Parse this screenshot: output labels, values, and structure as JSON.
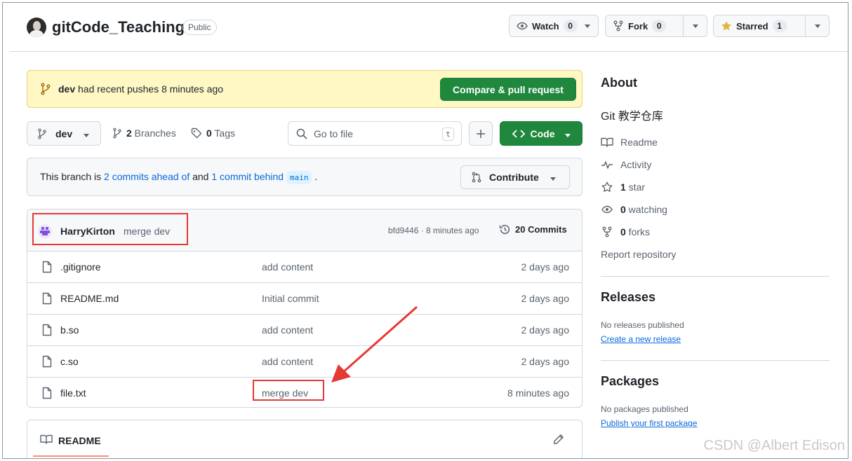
{
  "repo": {
    "name": "gitCode_Teaching",
    "visibility": "Public",
    "watch": {
      "label": "Watch",
      "count": "0"
    },
    "fork": {
      "label": "Fork",
      "count": "0"
    },
    "star": {
      "label": "Starred",
      "count": "1"
    }
  },
  "banner": {
    "branch": "dev",
    "text": " had recent pushes 8 minutes ago",
    "button": "Compare & pull request"
  },
  "toolbar": {
    "branch": "dev",
    "branches_count": "2",
    "branches_label": " Branches",
    "tags_count": "0",
    "tags_label": " Tags",
    "search_placeholder": "Go to file",
    "search_kbd": "t",
    "code_button": "Code"
  },
  "ahead_behind": {
    "prefix": "This branch is ",
    "ahead_link": "2 commits ahead of",
    "mid": " and ",
    "behind_link": "1 commit behind",
    "base": "main",
    "suffix": " .",
    "contribute": "Contribute"
  },
  "latest_commit": {
    "user": "HarryKirton",
    "message": "merge dev",
    "meta": "bfd9446 · 8 minutes ago",
    "commits_label": "20 Commits"
  },
  "files": [
    {
      "name": ".gitignore",
      "message": "add content",
      "time": "2 days ago"
    },
    {
      "name": "README.md",
      "message": "Initial commit",
      "time": "2 days ago"
    },
    {
      "name": "b.so",
      "message": "add content",
      "time": "2 days ago"
    },
    {
      "name": "c.so",
      "message": "add content",
      "time": "2 days ago"
    },
    {
      "name": "file.txt",
      "message": "merge dev",
      "time": "8 minutes ago"
    }
  ],
  "readme": {
    "title": "README"
  },
  "sidebar": {
    "about_title": "About",
    "description": "Git 教学仓库",
    "readme": "Readme",
    "activity": "Activity",
    "stars_count": "1",
    "stars_label": " star",
    "watching_count": "0",
    "watching_label": " watching",
    "forks_count": "0",
    "forks_label": " forks",
    "report": "Report repository",
    "releases_title": "Releases",
    "releases_empty": "No releases published",
    "releases_link": "Create a new release",
    "packages_title": "Packages",
    "packages_empty": "No packages published",
    "packages_link": "Publish your first package"
  },
  "watermark": "CSDN @Albert Edison",
  "colors": {
    "accent_green": "#1f883d",
    "link_blue": "#0969da",
    "annotation_red": "#e53935",
    "banner_yellow": "#fff8c5"
  }
}
